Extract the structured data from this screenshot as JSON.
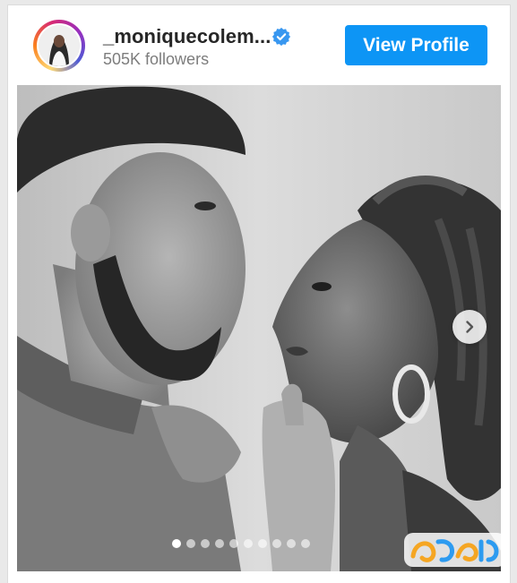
{
  "profile": {
    "username": "_moniquecolem...",
    "verified": true,
    "followers": "505K followers",
    "avatar_icon": "profile-avatar"
  },
  "actions": {
    "view_profile_label": "View Profile"
  },
  "carousel": {
    "next_icon": "chevron-right-icon",
    "slide_count": 10,
    "active_index": 0
  },
  "colors": {
    "accent": "#0d95f5",
    "verified": "#3897f0",
    "watermark": "#f5a623"
  }
}
